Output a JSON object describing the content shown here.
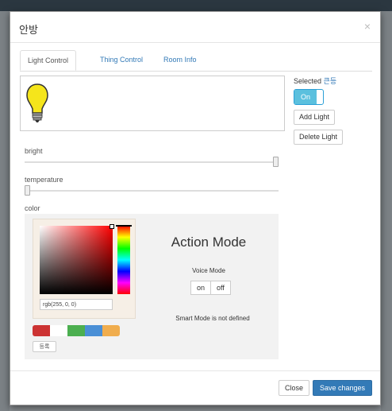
{
  "modal": {
    "title": "안방",
    "close_symbol": "×"
  },
  "tabs": [
    {
      "label": "Light Control",
      "active": true
    },
    {
      "label": "Thing Control",
      "active": false
    },
    {
      "label": "Room Info",
      "active": false
    }
  ],
  "side": {
    "selected_label": "Selected",
    "selected_value": "큰등",
    "toggle_label": "On",
    "add_light": "Add Light",
    "delete_light": "Delete Light"
  },
  "bulb_icon": "light-bulb",
  "sliders": {
    "bright_label": "bright",
    "bright_value": 1.0,
    "temperature_label": "temperature",
    "temperature_value": 0.0
  },
  "color": {
    "label": "color",
    "rgb_value": "rgb(255, 0, 0)",
    "swatches": [
      "#cc3333",
      "#ffffff",
      "#4caf50",
      "#4a8fd6",
      "#f0ad4e"
    ],
    "register_label": "등록"
  },
  "action": {
    "title": "Action Mode",
    "voice_label": "Voice Mode",
    "on": "on",
    "off": "off",
    "smart_text": "Smart Mode is not defined"
  },
  "footer": {
    "close": "Close",
    "save": "Save changes"
  },
  "colors": {
    "primary": "#337ab7",
    "toggle": "#5bc0de"
  }
}
